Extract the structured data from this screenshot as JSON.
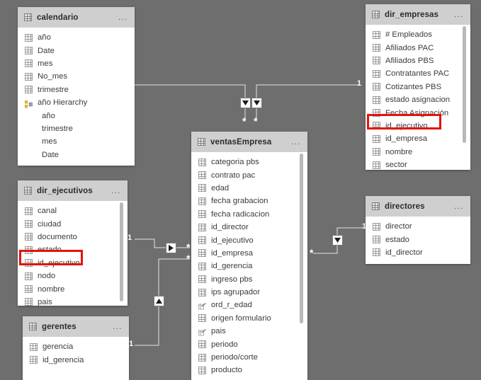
{
  "app": {
    "view": "model-relationships-diagram",
    "background_color": "#6e6e6e",
    "header_color": "#cfcfcf",
    "card_color": "#ffffff",
    "highlight_color": "#e4130d"
  },
  "tables": [
    {
      "name": "calendario",
      "menu": "...",
      "fields": [
        {
          "label": "año",
          "icon": "column-icon",
          "indent": 0
        },
        {
          "label": "Date",
          "icon": "column-icon",
          "indent": 0
        },
        {
          "label": "mes",
          "icon": "column-icon",
          "indent": 0
        },
        {
          "label": "No_mes",
          "icon": "column-icon",
          "indent": 0
        },
        {
          "label": "trimestre",
          "icon": "column-icon",
          "indent": 0
        },
        {
          "label": "año Hierarchy",
          "icon": "hierarchy-icon",
          "indent": 0
        },
        {
          "label": "año",
          "icon": "none",
          "indent": 1
        },
        {
          "label": "trimestre",
          "icon": "none",
          "indent": 1
        },
        {
          "label": "mes",
          "icon": "none",
          "indent": 1
        },
        {
          "label": "Date",
          "icon": "none",
          "indent": 1
        }
      ]
    },
    {
      "name": "dir_empresas",
      "menu": "...",
      "fields": [
        {
          "label": "# Empleados",
          "icon": "column-icon",
          "indent": 0
        },
        {
          "label": "Afiliados PAC",
          "icon": "column-icon",
          "indent": 0
        },
        {
          "label": "Afiliados PBS",
          "icon": "column-icon",
          "indent": 0
        },
        {
          "label": "Contratantes PAC",
          "icon": "column-icon",
          "indent": 0
        },
        {
          "label": "Cotizantes PBS",
          "icon": "column-icon",
          "indent": 0
        },
        {
          "label": "estado asignacion",
          "icon": "column-icon",
          "indent": 0
        },
        {
          "label": "Fecha Asignación",
          "icon": "column-icon",
          "indent": 0
        },
        {
          "label": "id_ejecutivo",
          "icon": "column-icon",
          "indent": 0,
          "highlighted": true
        },
        {
          "label": "id_empresa",
          "icon": "column-icon",
          "indent": 0
        },
        {
          "label": "nombre",
          "icon": "column-icon",
          "indent": 0
        },
        {
          "label": "sector",
          "icon": "column-icon",
          "indent": 0
        }
      ]
    },
    {
      "name": "ventasEmpresa",
      "menu": "...",
      "fields": [
        {
          "label": "categoria pbs",
          "icon": "column-icon",
          "indent": 0
        },
        {
          "label": "contrato pac",
          "icon": "column-icon",
          "indent": 0
        },
        {
          "label": "edad",
          "icon": "column-icon",
          "indent": 0
        },
        {
          "label": "fecha grabacion",
          "icon": "column-icon",
          "indent": 0
        },
        {
          "label": "fecha radicacion",
          "icon": "column-icon",
          "indent": 0
        },
        {
          "label": "id_director",
          "icon": "column-icon",
          "indent": 0
        },
        {
          "label": "id_ejecutivo",
          "icon": "column-icon",
          "indent": 0
        },
        {
          "label": "id_empresa",
          "icon": "column-icon",
          "indent": 0
        },
        {
          "label": "id_gerencia",
          "icon": "column-icon",
          "indent": 0
        },
        {
          "label": "ingreso pbs",
          "icon": "column-icon",
          "indent": 0
        },
        {
          "label": "ips agrupador",
          "icon": "column-icon",
          "indent": 0
        },
        {
          "label": "ord_r_edad",
          "icon": "calculated-column-icon",
          "indent": 0
        },
        {
          "label": "origen formulario",
          "icon": "column-icon",
          "indent": 0
        },
        {
          "label": "pais",
          "icon": "calculated-column-icon",
          "indent": 0
        },
        {
          "label": "periodo",
          "icon": "column-icon",
          "indent": 0
        },
        {
          "label": "periodo/corte",
          "icon": "column-icon",
          "indent": 0
        },
        {
          "label": "producto",
          "icon": "column-icon",
          "indent": 0
        }
      ]
    },
    {
      "name": "dir_ejecutivos",
      "menu": "...",
      "fields": [
        {
          "label": "canal",
          "icon": "column-icon",
          "indent": 0
        },
        {
          "label": "ciudad",
          "icon": "column-icon",
          "indent": 0
        },
        {
          "label": "documento",
          "icon": "column-icon",
          "indent": 0
        },
        {
          "label": "estado",
          "icon": "column-icon",
          "indent": 0
        },
        {
          "label": "id_ejecutivo",
          "icon": "column-icon",
          "indent": 0,
          "highlighted": true
        },
        {
          "label": "nodo",
          "icon": "column-icon",
          "indent": 0
        },
        {
          "label": "nombre",
          "icon": "column-icon",
          "indent": 0
        },
        {
          "label": "pais",
          "icon": "column-icon",
          "indent": 0
        }
      ]
    },
    {
      "name": "directores",
      "menu": "...",
      "fields": [
        {
          "label": "director",
          "icon": "column-icon",
          "indent": 0
        },
        {
          "label": "estado",
          "icon": "column-icon",
          "indent": 0
        },
        {
          "label": "id_director",
          "icon": "column-icon",
          "indent": 0
        }
      ]
    },
    {
      "name": "gerentes",
      "menu": "...",
      "fields": [
        {
          "label": "gerencia",
          "icon": "column-icon",
          "indent": 0
        },
        {
          "label": "id_gerencia",
          "icon": "column-icon",
          "indent": 0
        }
      ]
    }
  ],
  "relationships": [
    {
      "from": "calendario",
      "to": "ventasEmpresa",
      "one_label": "1",
      "many_label": "*",
      "cross_filter": "single-down"
    },
    {
      "from": "dir_empresas",
      "to": "ventasEmpresa",
      "one_label": "1",
      "many_label": "*",
      "cross_filter": "single-down"
    },
    {
      "from": "dir_ejecutivos",
      "to": "ventasEmpresa",
      "one_label": "1",
      "many_label": "*",
      "cross_filter": "single-right"
    },
    {
      "from": "gerentes",
      "to": "ventasEmpresa",
      "one_label": "1",
      "many_label": "*",
      "cross_filter": "single-up"
    },
    {
      "from": "directores",
      "to": "ventasEmpresa",
      "one_label": "1",
      "many_label": "*",
      "cross_filter": "single-down"
    }
  ],
  "cardinality_labels": {
    "one": "1",
    "many": "*"
  }
}
